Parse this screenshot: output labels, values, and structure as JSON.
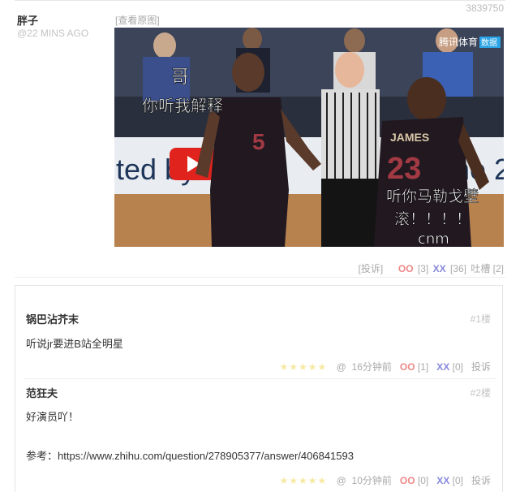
{
  "post": {
    "id": "3839750",
    "author": "胖子",
    "time": "@22 MINS AGO",
    "view_original": "[查看原图]",
    "image": {
      "overlay_text_1": "哥",
      "overlay_text_2": "你听我解释",
      "overlay_text_3": "听你马勒戈壁",
      "overlay_text_4": "滚！！！！",
      "overlay_text_5": "cnm",
      "watermark": "腾讯体育",
      "watermark_badge": "数据",
      "bg_text_left": "ted by",
      "bg_text_right": "ne 2",
      "jersey_left_name": "",
      "jersey_left_number": "5",
      "jersey_right_name": "JAMES",
      "jersey_right_number": "23"
    },
    "actions": {
      "report": "[投诉]",
      "oo_label": "OO",
      "oo_count": "[3]",
      "xx_label": "XX",
      "xx_count": "[36]",
      "tucao": "吐槽 [2]"
    }
  },
  "comments": [
    {
      "author": "锅巴沾芥末",
      "floor": "#1楼",
      "text": "听说jr要进B站全明星",
      "stars": "★★★★★",
      "at": "@",
      "time": "16分钟前",
      "oo_label": "OO",
      "oo_count": "[1]",
      "xx_label": "XX",
      "xx_count": "[0]",
      "report": "投诉"
    },
    {
      "author": "范狂夫",
      "floor": "#2楼",
      "text": "好演员吖！",
      "text2": "参考：https://www.zhihu.com/question/278905377/answer/406841593",
      "stars": "★★★★★",
      "at": "@",
      "time": "10分钟前",
      "oo_label": "OO",
      "oo_count": "[0]",
      "xx_label": "XX",
      "xx_count": "[0]",
      "report": "投诉"
    }
  ],
  "colors": {
    "oo": "#ee8888",
    "xx": "#8888dd",
    "meta": "#aaaaaa"
  }
}
